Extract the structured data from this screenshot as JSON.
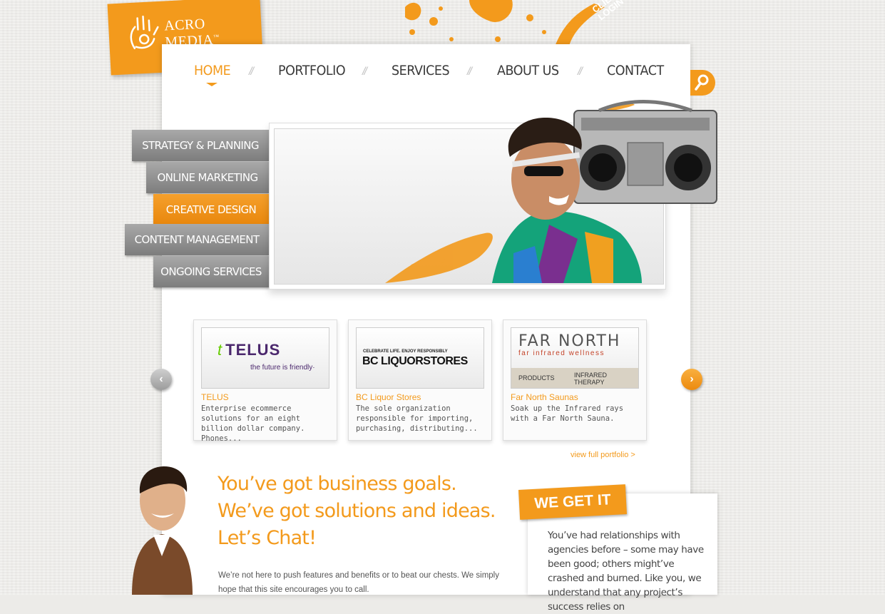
{
  "brand": {
    "logo_text": "ACRO MEDIA",
    "tm": "™",
    "client_login": "CLIENT LOGIN"
  },
  "nav": [
    {
      "label": "HOME",
      "active": true
    },
    {
      "label": "PORTFOLIO",
      "active": false
    },
    {
      "label": "SERVICES",
      "active": false
    },
    {
      "label": "ABOUT US",
      "active": false
    },
    {
      "label": "CONTACT",
      "active": false
    }
  ],
  "nav_separator": "//",
  "search_icon": "magnifier-icon",
  "services": [
    {
      "label": "STRATEGY & PLANNING",
      "active": false
    },
    {
      "label": "ONLINE MARKETING",
      "active": false
    },
    {
      "label": "CREATIVE DESIGN",
      "active": true
    },
    {
      "label": "CONTENT MANAGEMENT",
      "active": false
    },
    {
      "label": "ONGOING SERVICES",
      "active": false
    }
  ],
  "portfolio": [
    {
      "title": "TELUS",
      "desc": "Enterprise ecommerce solutions for an eight billion dollar company. Phones...",
      "logo_main": "TELUS",
      "logo_sub": "the future is friendly·"
    },
    {
      "title": "BC Liquor Stores",
      "desc": "The sole organization responsible for importing, purchasing, distributing...",
      "logo_top": "CELEBRATE LIFE. ENJOY RESPONSIBLY",
      "logo_main": "BC LIQUORSTORES"
    },
    {
      "title": "Far North Saunas",
      "desc": "Soak up the Infrared rays with a Far North Sauna.",
      "logo_main": "FAR NORTH",
      "logo_sub": "far infrared wellness",
      "tab1": "PRODUCTS",
      "tab2": "INFRARED THERAPY"
    }
  ],
  "prev_arrow": "‹",
  "next_arrow": "›",
  "view_full_portfolio": "view full portfolio >",
  "headline": "You’ve got business goals. We’ve got solutions and ideas. Let’s Chat!",
  "body": "We’re not here to push features and benefits or to beat our chests. We simply hope that this site encourages you to call.",
  "we_get_it": {
    "tag": "WE GET IT",
    "text": "You’ve had relationships with agencies before – some may have been good; others might’ve crashed and burned. Like you, we understand that any project’s success relies on"
  },
  "colors": {
    "accent": "#f39a1c",
    "nav_text": "#3a3a3a",
    "menu_gray": "#8e8e8e"
  }
}
